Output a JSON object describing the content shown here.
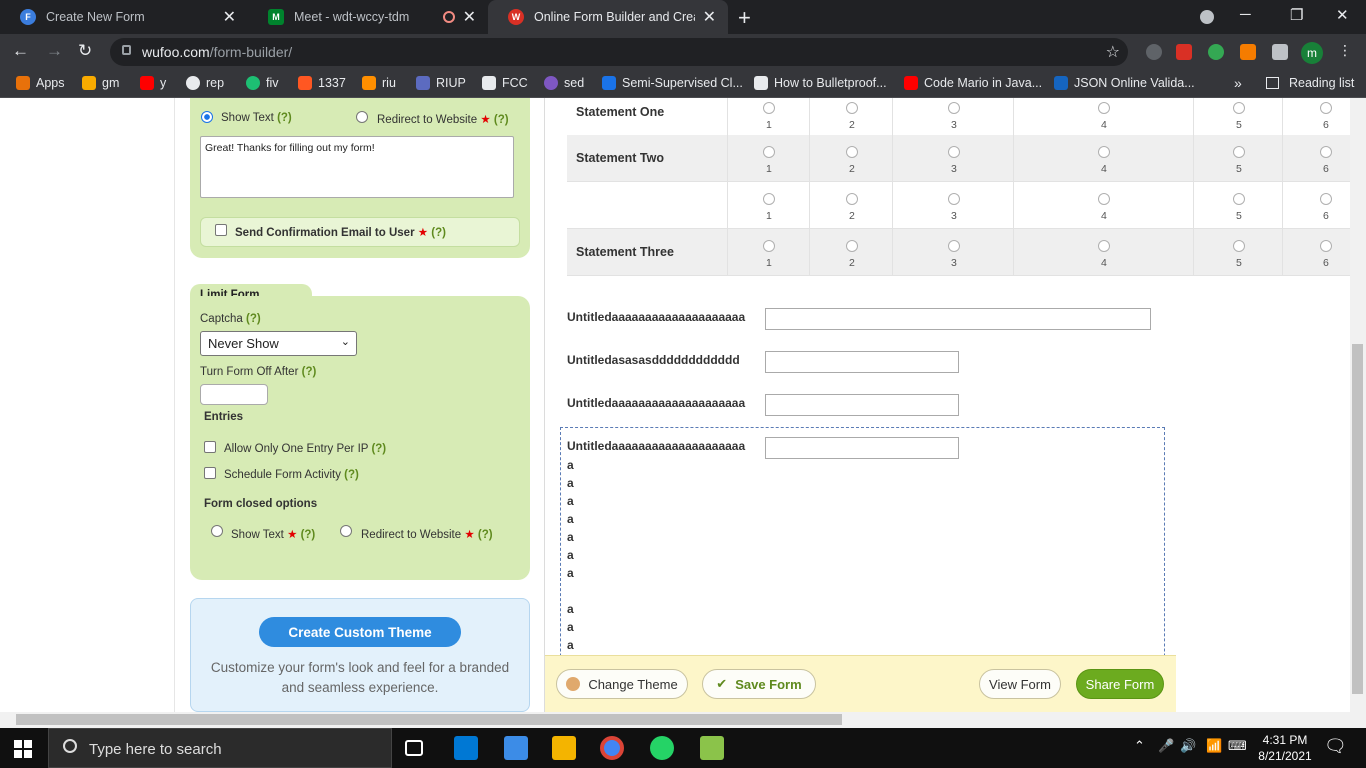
{
  "browser": {
    "tabs": [
      {
        "title": "Create New Form",
        "favicon": "F",
        "color": "#3b7ddd",
        "active": false
      },
      {
        "title": "Meet - wdt-wccy-tdm",
        "favicon": "M",
        "color": "#00832d",
        "active": false,
        "recording": true
      },
      {
        "title": "Online Form Builder and Creator",
        "favicon": "W",
        "color": "#d93025",
        "active": true
      }
    ],
    "new_tab_icon": "+",
    "window_controls": [
      "─",
      "❐",
      "✕"
    ],
    "url_domain": "wufoo.com",
    "url_path": "/form-builder/",
    "profile_initial": "m",
    "bookmarks": [
      {
        "label": "Apps",
        "color": "#e8710a"
      },
      {
        "label": "gm",
        "color": "#f9ab00"
      },
      {
        "label": "y",
        "color": "#ff0000"
      },
      {
        "label": "rep",
        "color": "#e8eaed"
      },
      {
        "label": "fiv",
        "color": "#1dbf73"
      },
      {
        "label": "1337",
        "color": "#ff5722"
      },
      {
        "label": "riu",
        "color": "#ff8f00"
      },
      {
        "label": "RIUP",
        "color": "#5c6bc0"
      },
      {
        "label": "FCC",
        "color": "#e8eaed"
      },
      {
        "label": "sed",
        "color": "#7e57c2"
      },
      {
        "label": "Semi-Supervised Cl...",
        "color": "#1a73e8"
      },
      {
        "label": "How to Bulletproof...",
        "color": "#e8eaed"
      },
      {
        "label": "Code Mario in Java...",
        "color": "#ff0000"
      },
      {
        "label": "JSON Online Valida...",
        "color": "#1565c0"
      }
    ],
    "bookmarks_more": "»",
    "reading_list": "Reading list"
  },
  "sidebar": {
    "show_text_label": "Show Text",
    "redirect_label": "Redirect to Website",
    "help": "(?)",
    "required_star": "★",
    "confirmation_message": "Great! Thanks for filling out my form!",
    "send_confirmation_label": "Send Confirmation Email to User",
    "limit_section_title": "Limit Form Activity",
    "captcha_label": "Captcha",
    "captcha_value": "Never Show",
    "turn_off_label": "Turn Form Off After",
    "entries_label": "Entries",
    "one_entry_label": "Allow Only One Entry Per IP",
    "schedule_label": "Schedule Form Activity",
    "closed_options_label": "Form closed options",
    "closed_show_text": "Show Text",
    "closed_redirect": "Redirect to Website",
    "theme_button": "Create Custom Theme",
    "theme_text": "Customize your form's look and feel for a branded and seamless experience."
  },
  "form": {
    "matrix_rows": [
      "Statement One",
      "Statement Two",
      "",
      "Statement Three"
    ],
    "matrix_columns": [
      "1",
      "2",
      "3",
      "4",
      "5",
      "6"
    ],
    "fields": [
      "Untitledaaaaaaaaaaaaaaaaaaaa",
      "Untitledasasasdddddddddddd",
      "Untitledaaaaaaaaaaaaaaaaaaaa",
      "Untitledaaaaaaaaaaaaaaaaaaaa"
    ],
    "extra_lines": [
      "a",
      "a",
      "a",
      "a",
      "a",
      "a",
      "a",
      "",
      "a",
      "a",
      "a"
    ]
  },
  "bottombar": {
    "change_theme": "Change Theme",
    "save_form": "Save Form",
    "view_form": "View Form",
    "share_form": "Share Form"
  },
  "taskbar": {
    "search_placeholder": "Type here to search",
    "time": "4:31 PM",
    "date": "8/21/2021"
  }
}
